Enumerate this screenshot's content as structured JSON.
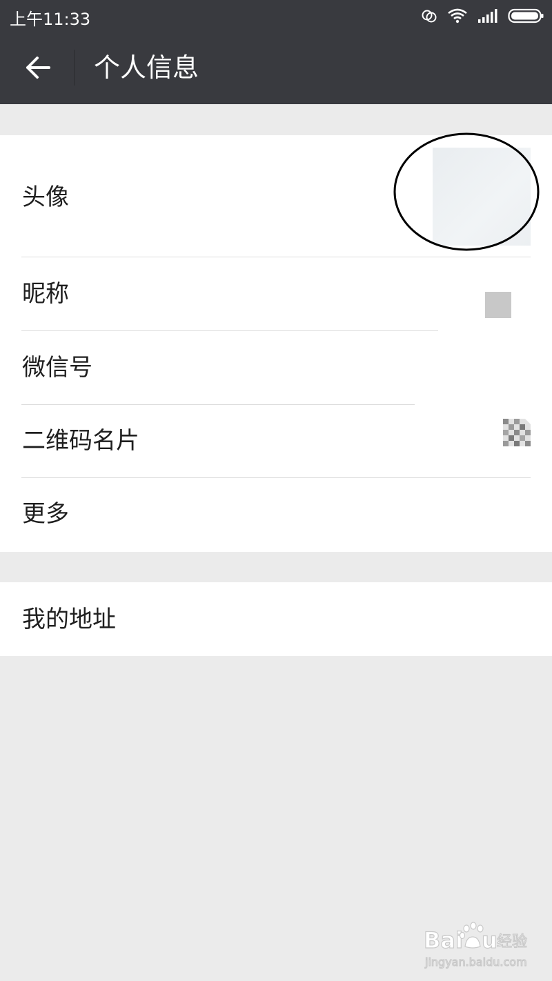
{
  "status_bar": {
    "time": "上午11:33",
    "icons": [
      "dual-ring-icon",
      "wifi-icon",
      "signal-icon",
      "battery-icon"
    ]
  },
  "header": {
    "title": "个人信息",
    "back_icon": "arrow-left-icon"
  },
  "profile_group": {
    "items": [
      {
        "label": "头像"
      },
      {
        "label": "昵称"
      },
      {
        "label": "微信号"
      },
      {
        "label": "二维码名片"
      },
      {
        "label": "更多"
      }
    ]
  },
  "address_group": {
    "label": "我的地址"
  },
  "watermark": {
    "brand_latin_a": "Bai",
    "brand_latin_b": "u",
    "brand_cn": "经验",
    "url": "jingyan.baidu.com"
  },
  "colors": {
    "header_bg": "#393a3f",
    "page_bg": "#ebebeb",
    "row_bg": "#ffffff",
    "annotation": "#000000"
  }
}
